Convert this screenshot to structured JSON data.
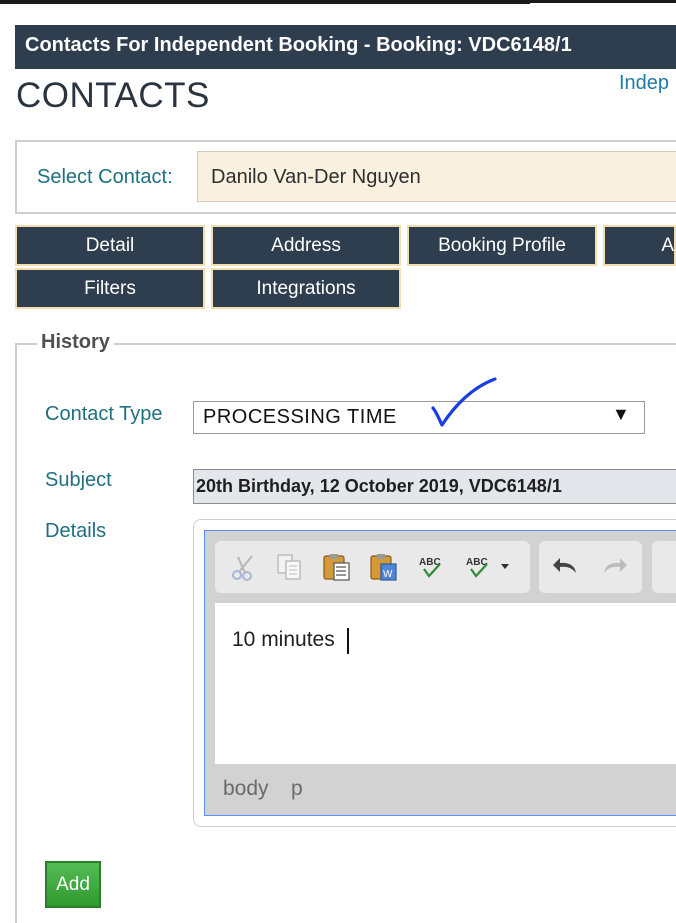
{
  "header": {
    "title": "Contacts For Independent Booking - Booking: VDC6148/1",
    "heading": "CONTACTS",
    "link_partial": "Indep"
  },
  "contact_select": {
    "label": "Select Contact:",
    "value": "Danilo Van-Der Nguyen"
  },
  "tabs": [
    {
      "label": "Detail"
    },
    {
      "label": "Address"
    },
    {
      "label": "Booking Profile"
    },
    {
      "label": "A"
    },
    {
      "label": "Filters"
    },
    {
      "label": "Integrations"
    }
  ],
  "history": {
    "legend": "History",
    "contact_type_label": "Contact Type",
    "contact_type_value": "PROCESSING TIME",
    "dropdown_arrow": "▼",
    "subject_label": "Subject",
    "subject_value": "20th Birthday, 12 October 2019, VDC6148/1",
    "details_label": "Details",
    "editor": {
      "content": "10 minutes",
      "path": [
        "body",
        "p"
      ],
      "toolbar_icons": [
        "cut-icon",
        "copy-icon",
        "paste-icon",
        "paste-from-word-icon",
        "spellcheck-icon",
        "spellcheck-as-you-type-icon",
        "undo-icon",
        "redo-icon"
      ]
    },
    "add_button": "Add"
  },
  "colors": {
    "titlebar": "#2e3e4f",
    "tab_border": "#f3dcad",
    "label_teal": "#1f6f80",
    "select_bg": "#f9f0df",
    "add_green": "#3ea53e",
    "annotation_blue": "#1a3fe0"
  }
}
